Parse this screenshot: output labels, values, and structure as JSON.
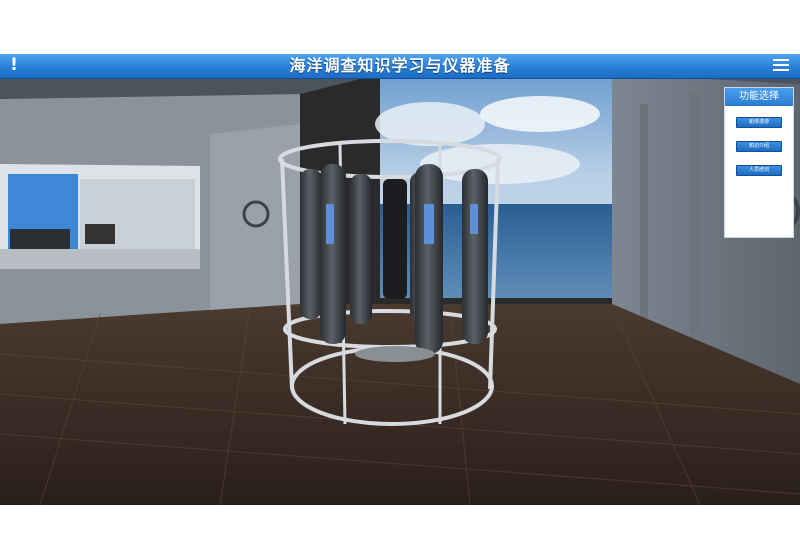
{
  "header": {
    "title": "海洋调查知识学习与仪器准备",
    "alert_icon": "!",
    "menu_icon": "menu-icon"
  },
  "function_panel": {
    "title": "功能选择",
    "buttons": [
      {
        "label": "船体漫游"
      },
      {
        "label": "知识介绍"
      },
      {
        "label": "人员培训"
      }
    ]
  },
  "scene": {
    "description_icon": "ctd-rosette-sampler"
  },
  "colors": {
    "titlebar_blue": "#2b7fd6",
    "panel_header_blue": "#3a8fe0"
  }
}
